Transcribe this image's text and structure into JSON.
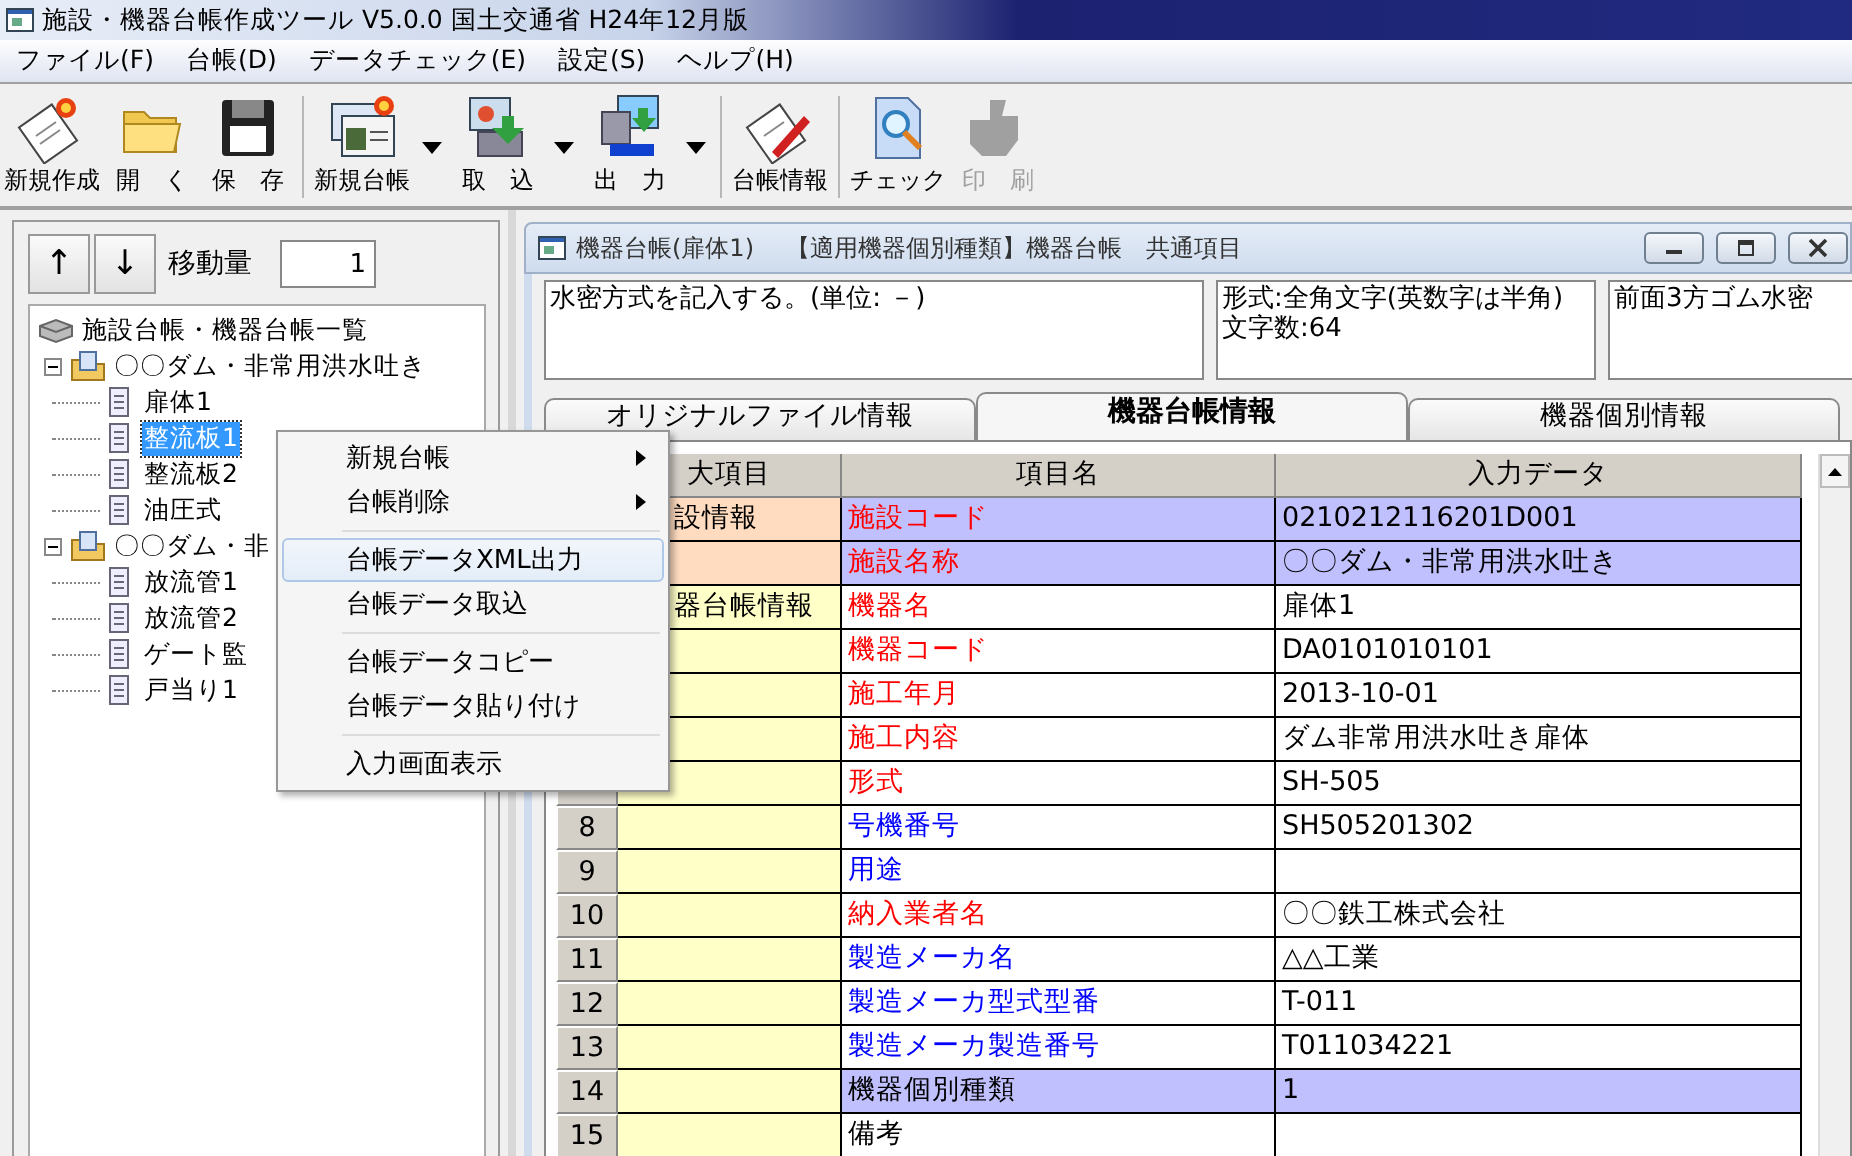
{
  "window": {
    "title": "施設・機器台帳作成ツール V5.0.0 国土交通省 H24年12月版"
  },
  "menu_bar": [
    "ファイル(F)",
    "台帳(D)",
    "データチェック(E)",
    "設定(S)",
    "ヘルプ(H)"
  ],
  "toolbar": [
    {
      "label": "新規作成",
      "has_menu": false,
      "disabled": false
    },
    {
      "label": "開　く",
      "has_menu": false,
      "disabled": false
    },
    {
      "label": "保　存",
      "has_menu": false,
      "disabled": false
    },
    {
      "label": "新規台帳",
      "has_menu": true,
      "disabled": false
    },
    {
      "label": "取　込",
      "has_menu": true,
      "disabled": false
    },
    {
      "label": "出　力",
      "has_menu": true,
      "disabled": false
    },
    {
      "label": "台帳情報",
      "has_menu": false,
      "disabled": false
    },
    {
      "label": "チェック",
      "has_menu": false,
      "disabled": false
    },
    {
      "label": "印　刷",
      "has_menu": false,
      "disabled": true
    }
  ],
  "left_panel": {
    "up_button": "↑",
    "down_button": "↓",
    "step_label": "移動量",
    "step_value": "1",
    "tree": {
      "label": "施設台帳・機器台帳一覧",
      "children": [
        {
          "label": "〇〇ダム・非常用洪水吐き",
          "expanded": true,
          "children": [
            {
              "label": "扉体1",
              "selected": false
            },
            {
              "label": "整流板1",
              "selected": true
            },
            {
              "label": "整流板2",
              "selected": false
            },
            {
              "label": "油圧式",
              "selected": false
            }
          ]
        },
        {
          "label": "〇〇ダム・非",
          "expanded": true,
          "children": [
            {
              "label": "放流管1",
              "selected": false
            },
            {
              "label": "放流管2",
              "selected": false
            },
            {
              "label": "ゲート監",
              "selected": false
            },
            {
              "label": "戸当り1",
              "selected": false
            }
          ]
        }
      ]
    }
  },
  "context_menu": [
    {
      "kind": "item",
      "label": "新規台帳",
      "submenu": true,
      "selected": false
    },
    {
      "kind": "item",
      "label": "台帳削除",
      "submenu": true,
      "selected": false
    },
    {
      "kind": "separator"
    },
    {
      "kind": "item",
      "label": "台帳データXML出力",
      "submenu": false,
      "selected": true
    },
    {
      "kind": "item",
      "label": "台帳データ取込",
      "submenu": false,
      "selected": false
    },
    {
      "kind": "separator"
    },
    {
      "kind": "item",
      "label": "台帳データコピー",
      "submenu": false,
      "selected": false
    },
    {
      "kind": "item",
      "label": "台帳データ貼り付け",
      "submenu": false,
      "selected": false
    },
    {
      "kind": "separator"
    },
    {
      "kind": "item",
      "label": "入力画面表示",
      "submenu": false,
      "selected": false
    }
  ],
  "sub_window": {
    "title": "機器台帳(扉体1)　 【適用機器個別種類】機器台帳　共通項目",
    "description": "水密方式を記入する。(単位: －)",
    "format_lines": [
      "形式:全角文字(英数字は半角)",
      "文字数:64"
    ],
    "current_value": "前面3方ゴム水密",
    "tabs": [
      {
        "label": "オリジナルファイル情報",
        "selected": false
      },
      {
        "label": "機器台帳情報",
        "selected": true
      },
      {
        "label": "機器個別情報",
        "selected": false
      }
    ],
    "table": {
      "columns": [
        "大項目",
        "項目名",
        "入力データ"
      ],
      "rows": [
        {
          "category": {
            "label": "設情報",
            "color": "#ffdcc0"
          },
          "item": {
            "label": "施設コード",
            "color": "#ff0000"
          },
          "value": "0210212116201D001",
          "highlighted": true
        },
        {
          "category": {
            "color": "#ffdcc0"
          },
          "item": {
            "label": "施設名称",
            "color": "#ff0000"
          },
          "value": "〇〇ダム・非常用洪水吐き",
          "highlighted": true
        },
        {
          "category": {
            "label": "器台帳情報",
            "color": "#ffffc8"
          },
          "item": {
            "label": "機器名",
            "color": "#ff0000"
          },
          "value": "扉体1",
          "highlighted": false
        },
        {
          "category": {
            "color": "#ffffc8"
          },
          "item": {
            "label": "機器コード",
            "color": "#ff0000"
          },
          "value": "DA0101010101",
          "highlighted": false
        },
        {
          "category": {
            "color": "#ffffc8"
          },
          "item": {
            "label": "施工年月",
            "color": "#ff0000"
          },
          "value": "2013-10-01",
          "highlighted": false
        },
        {
          "category": {
            "color": "#ffffc8"
          },
          "item": {
            "label": "施工内容",
            "color": "#ff0000"
          },
          "value": "ダム非常用洪水吐き扉体",
          "highlighted": false
        },
        {
          "category": {
            "color": "#ffffc8"
          },
          "item": {
            "label": "形式",
            "color": "#ff0000"
          },
          "value": "SH-505",
          "highlighted": false
        },
        {
          "no": "8",
          "category": {
            "color": "#ffffc8"
          },
          "item": {
            "label": "号機番号",
            "color": "#0000ff"
          },
          "value": "SH505201302",
          "highlighted": false
        },
        {
          "no": "9",
          "category": {
            "color": "#ffffc8"
          },
          "item": {
            "label": "用途",
            "color": "#0000ff"
          },
          "highlighted": false
        },
        {
          "no": "10",
          "category": {
            "color": "#ffffc8"
          },
          "item": {
            "label": "納入業者名",
            "color": "#ff0000"
          },
          "value": "〇〇鉄工株式会社",
          "highlighted": false
        },
        {
          "no": "11",
          "category": {
            "color": "#ffffc8"
          },
          "item": {
            "label": "製造メーカ名",
            "color": "#0000ff"
          },
          "value": "△△工業",
          "highlighted": false
        },
        {
          "no": "12",
          "category": {
            "color": "#ffffc8"
          },
          "item": {
            "label": "製造メーカ型式型番",
            "color": "#0000ff"
          },
          "value": "T-011",
          "highlighted": false
        },
        {
          "no": "13",
          "category": {
            "color": "#ffffc8"
          },
          "item": {
            "label": "製造メーカ製造番号",
            "color": "#0000ff"
          },
          "value": "T011034221",
          "highlighted": false
        },
        {
          "no": "14",
          "category": {
            "color": "#ffffc8"
          },
          "item": {
            "label": "機器個別種類",
            "color": "#000000"
          },
          "value": "1",
          "highlighted": true
        },
        {
          "no": "15",
          "category": {
            "color": "#ffffc8"
          },
          "item": {
            "label": "備考",
            "color": "#000000"
          },
          "highlighted": false
        }
      ]
    }
  }
}
